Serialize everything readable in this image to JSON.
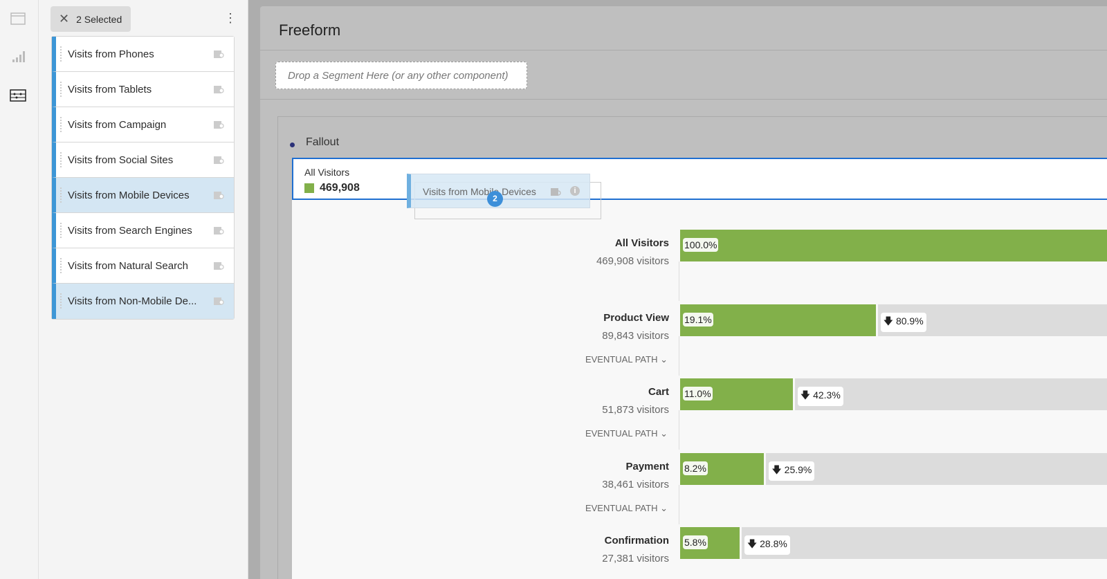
{
  "rail": {
    "icons": [
      "panel-icon",
      "visualization-icon",
      "components-icon"
    ]
  },
  "panel": {
    "selected_label": "2 Selected",
    "items": [
      {
        "label": "Visits from Phones",
        "selected": false
      },
      {
        "label": "Visits from Tablets",
        "selected": false
      },
      {
        "label": "Visits from Campaign",
        "selected": false
      },
      {
        "label": "Visits from Social Sites",
        "selected": false
      },
      {
        "label": "Visits from Mobile Devices",
        "selected": true
      },
      {
        "label": "Visits from Search Engines",
        "selected": false
      },
      {
        "label": "Visits from Natural Search",
        "selected": false
      },
      {
        "label": "Visits from Non-Mobile De...",
        "selected": true
      }
    ]
  },
  "main": {
    "title": "Freeform",
    "drop_placeholder": "Drop a Segment Here (or any other component)"
  },
  "fallout": {
    "title": "Fallout",
    "header_label": "All Visitors",
    "header_value": "469,908",
    "drag": {
      "label": "Visits from Mobile Devices",
      "count": "2"
    },
    "steps": [
      {
        "name": "All Visitors",
        "visitors": "469,908 visitors",
        "pct": 100.0,
        "pct_label": "100.0%",
        "drop_label": "",
        "path": ""
      },
      {
        "name": "Product View",
        "visitors": "89,843 visitors",
        "pct": 19.1,
        "pct_label": "19.1%",
        "drop_label": "80.9%",
        "path": "EVENTUAL PATH"
      },
      {
        "name": "Cart",
        "visitors": "51,873 visitors",
        "pct": 11.0,
        "pct_label": "11.0%",
        "drop_label": "42.3%",
        "path": "EVENTUAL PATH"
      },
      {
        "name": "Payment",
        "visitors": "38,461 visitors",
        "pct": 8.2,
        "pct_label": "8.2%",
        "drop_label": "25.9%",
        "path": "EVENTUAL PATH"
      },
      {
        "name": "Confirmation",
        "visitors": "27,381 visitors",
        "pct": 5.8,
        "pct_label": "5.8%",
        "drop_label": "28.8%",
        "path": ""
      }
    ]
  },
  "colors": {
    "accent": "#3d96d6",
    "bar": "#82b04a",
    "dropoff": "#dcdcdc",
    "focus": "#1f6fd1"
  }
}
